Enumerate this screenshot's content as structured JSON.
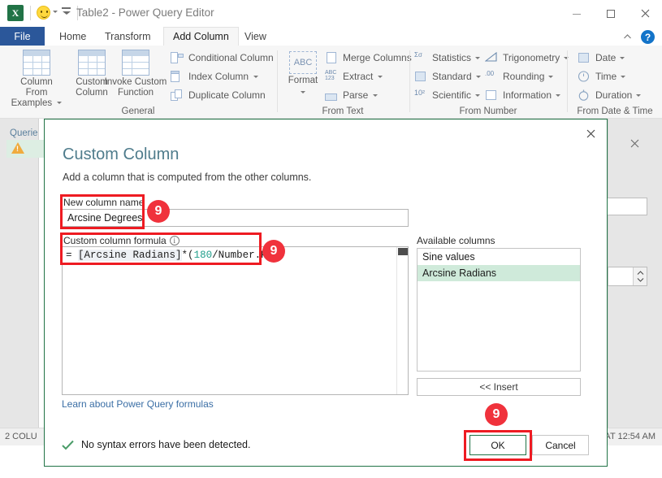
{
  "window": {
    "title": "Table2 - Power Query Editor",
    "logo_text": "X",
    "controls": {
      "minimize": "minimize-icon",
      "maximize": "maximize-icon",
      "close": "close-icon"
    }
  },
  "ribbon": {
    "tabs": [
      {
        "label": "File",
        "active": false
      },
      {
        "label": "Home",
        "active": false
      },
      {
        "label": "Transform",
        "active": false
      },
      {
        "label": "Add Column",
        "active": true
      },
      {
        "label": "View",
        "active": false
      }
    ],
    "help_badge": "?",
    "groups": [
      {
        "name": "General",
        "big_buttons": [
          {
            "label_line1": "Column From",
            "label_line2": "Examples",
            "dropdown": true
          },
          {
            "label_line1": "Custom",
            "label_line2": "Column",
            "dropdown": false
          },
          {
            "label_line1": "Invoke Custom",
            "label_line2": "Function",
            "dropdown": false
          }
        ],
        "small_buttons": [
          {
            "label": "Conditional Column",
            "dropdown": false
          },
          {
            "label": "Index Column",
            "dropdown": true
          },
          {
            "label": "Duplicate Column",
            "dropdown": false
          }
        ]
      },
      {
        "name": "From Text",
        "big_buttons": [
          {
            "label_line1": "Format",
            "label_line2": "",
            "dropdown": true
          }
        ],
        "small_buttons": [
          {
            "label": "Merge Columns",
            "dropdown": false
          },
          {
            "label": "Extract",
            "dropdown": true
          },
          {
            "label": "Parse",
            "dropdown": true
          }
        ]
      },
      {
        "name": "From Number",
        "small_buttons": [
          {
            "label": "Statistics",
            "dropdown": true
          },
          {
            "label": "Standard",
            "dropdown": true
          },
          {
            "label": "Scientific",
            "dropdown": true
          },
          {
            "label": "Trigonometry",
            "dropdown": true
          },
          {
            "label": "Rounding",
            "dropdown": true
          },
          {
            "label": "Information",
            "dropdown": true
          }
        ]
      },
      {
        "name": "From Date & Time",
        "small_buttons": [
          {
            "label": "Date",
            "dropdown": true
          },
          {
            "label": "Time",
            "dropdown": true
          },
          {
            "label": "Duration",
            "dropdown": true
          }
        ]
      }
    ]
  },
  "background": {
    "queries_label": "Querie",
    "status_left": "2 COLU",
    "status_right": "AT 12:54 AM"
  },
  "dialog": {
    "title": "Custom Column",
    "subtitle": "Add a column that is computed from the other columns.",
    "new_column_name_label": "New column name",
    "new_column_name_value": "Arcsine Degrees",
    "formula_label": "Custom column formula",
    "formula": {
      "prefix": "= ",
      "column_ref": "[Arcsine Radians]",
      "operator": "*(",
      "number": "180",
      "suffix": "/Number.PI)"
    },
    "learn_link": "Learn about Power Query formulas",
    "syntax_status": "No syntax errors have been detected.",
    "available_columns_label": "Available columns",
    "available_columns": [
      {
        "label": "Sine values",
        "selected": false
      },
      {
        "label": "Arcsine Radians",
        "selected": true
      }
    ],
    "insert_button": "<< Insert",
    "ok_button": "OK",
    "cancel_button": "Cancel"
  },
  "annotations": {
    "badges": [
      {
        "text": "9"
      },
      {
        "text": "9"
      },
      {
        "text": "9"
      }
    ],
    "accent_color": "#ee1b22",
    "badge_color": "#f0323c"
  },
  "colors": {
    "excel_green": "#217346",
    "ribbon_bg": "#f6f6f6",
    "dialog_border": "#217346",
    "selection_green": "#cfeada",
    "link_blue": "#3a6ea5",
    "title_teal": "#4f7c8c",
    "formula_number": "#1f9e8a"
  }
}
